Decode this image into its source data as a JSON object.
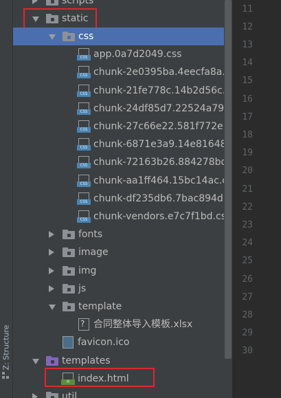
{
  "side_panel": {
    "structure_label": "Z: Structure"
  },
  "tree": [
    {
      "label": "scripts",
      "kind": "folder",
      "arrow": "right",
      "indent": 1
    },
    {
      "label": "static",
      "kind": "folder",
      "arrow": "down",
      "indent": 1,
      "highlight": true
    },
    {
      "label": "css",
      "kind": "folder",
      "arrow": "down",
      "indent": 2,
      "selected": true
    },
    {
      "label": "app.0a7d2049.css",
      "kind": "css",
      "indent": 3
    },
    {
      "label": "chunk-2e0395ba.4eecfa8a.c",
      "kind": "css",
      "indent": 3
    },
    {
      "label": "chunk-21fe778c.14b2d56c.c",
      "kind": "css",
      "indent": 3
    },
    {
      "label": "chunk-24df85d7.22524a79.c",
      "kind": "css",
      "indent": 3
    },
    {
      "label": "chunk-27c66e22.581f772e.c",
      "kind": "css",
      "indent": 3
    },
    {
      "label": "chunk-6871e3a9.14e81648.",
      "kind": "css",
      "indent": 3
    },
    {
      "label": "chunk-72163b26.884278bd",
      "kind": "css",
      "indent": 3
    },
    {
      "label": "chunk-aa1ff464.15bc14ac.cs",
      "kind": "css",
      "indent": 3
    },
    {
      "label": "chunk-df235db6.7bac894d.",
      "kind": "css",
      "indent": 3
    },
    {
      "label": "chunk-vendors.e7c7f1bd.cs",
      "kind": "css",
      "indent": 3
    },
    {
      "label": "fonts",
      "kind": "folder",
      "arrow": "right",
      "indent": 2
    },
    {
      "label": "image",
      "kind": "folder",
      "arrow": "right",
      "indent": 2
    },
    {
      "label": "img",
      "kind": "folder",
      "arrow": "right",
      "indent": 2
    },
    {
      "label": "js",
      "kind": "folder",
      "arrow": "right",
      "indent": 2
    },
    {
      "label": "template",
      "kind": "folder",
      "arrow": "down",
      "indent": 2
    },
    {
      "label": "合同整体导入模板.xlsx",
      "kind": "unknown",
      "indent": 3
    },
    {
      "label": "favicon.ico",
      "kind": "image",
      "indent": 2
    },
    {
      "label": "templates",
      "kind": "folder-purple",
      "arrow": "down",
      "indent": 1
    },
    {
      "label": "index.html",
      "kind": "html",
      "indent": 2,
      "highlight": true
    },
    {
      "label": "util",
      "kind": "folder",
      "arrow": "right",
      "indent": 1
    }
  ],
  "line_numbers": [
    "11",
    "12",
    "13",
    "14",
    "15",
    "16",
    "17",
    "18",
    "19",
    "20",
    "21",
    "22",
    "23",
    "24",
    "25",
    "26",
    "27",
    "28",
    "29",
    "30"
  ],
  "colors": {
    "selection": "#4b6eaf",
    "highlight_box": "#e0262c",
    "css_badge": "#4a84b3",
    "folder": "#8d9196",
    "templates_folder": "#8067bd"
  }
}
